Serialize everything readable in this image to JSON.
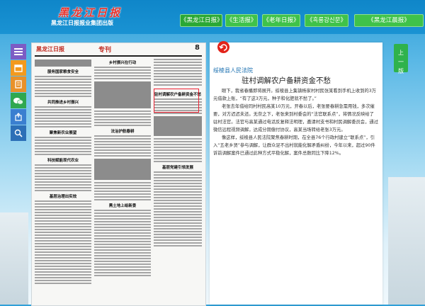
{
  "header": {
    "logo_title": "黑龙江日报",
    "logo_subtitle": "黑龙江日报报业集团出版",
    "tabs": [
      "《黑龙江日报》",
      "《生活报》",
      "《老年日报》",
      "《흑룡강신문》",
      "《黑龙江晨报》"
    ]
  },
  "sidebar": {
    "buttons": [
      {
        "icon": "menu-icon",
        "color": "#7c5cc4"
      },
      {
        "icon": "calendar-icon",
        "color": "#f39a1e"
      },
      {
        "icon": "document-icon",
        "color": "#e8912a"
      },
      {
        "icon": "wechat-icon",
        "color": "#2fa84f"
      },
      {
        "icon": "share-icon",
        "color": "#3a7fd0"
      },
      {
        "icon": "search-icon",
        "color": "#2c6fb7"
      }
    ]
  },
  "newspaper": {
    "masthead": "黑龙江日报",
    "section": "专刊",
    "page_number": "8",
    "headlines": [
      "服务国家粮食安全",
      "共同推进乡村振兴",
      "驻村调解农户备耕资金不愁",
      "聚焦新农业展望",
      "科技赋能现代农业",
      "乡村振兴在行动",
      "基层治理出实效",
      "法治护航春耕",
      "黑土地上绘新景",
      "基层党建引领发展"
    ]
  },
  "article": {
    "source": "绥棱县人民法院",
    "title": "驻村调解农户备耕资金不愁",
    "paragraphs": [
      "眼下，我省春播即将展开。绥棱县上集镇杨家村村民张某看到手机上收到的3万元借款上账，“有了这3万元，种子和化肥就不愁了。”",
      "老张去年借给同村村民高某10万元，开春以后，老张要春耕急需用钱，多次催要，对方迟迟未还。无奈之下，老张来到村委会的“法官联系点”，将情况反映给了驻村法官。法官与高某通过电话反复释法明理，邀请村支书和村民调解委员会，通过微信远程视频调解，达成分期偿付协议，高某当场转给老张3万元。",
      "像这样，绥棱县人民法院聚焦春耕时期，在全县76个行政村建立“联系点”，引入“五老乡贤”参与调解，让群众足不出村就能化解矛盾纠纷，今年以来，超过90件诉前调解案件已通过此种方式平稳化解，案件总数同比下降12%。"
    ]
  },
  "nav": {
    "prev_label_1": "上",
    "prev_label_2": "一",
    "prev_label_3": "版"
  },
  "colors": {
    "header_bg": "#1a93d3",
    "tab_green": "#3fc24a",
    "accent_red": "#e2231a",
    "source_blue": "#1a6fb0"
  }
}
